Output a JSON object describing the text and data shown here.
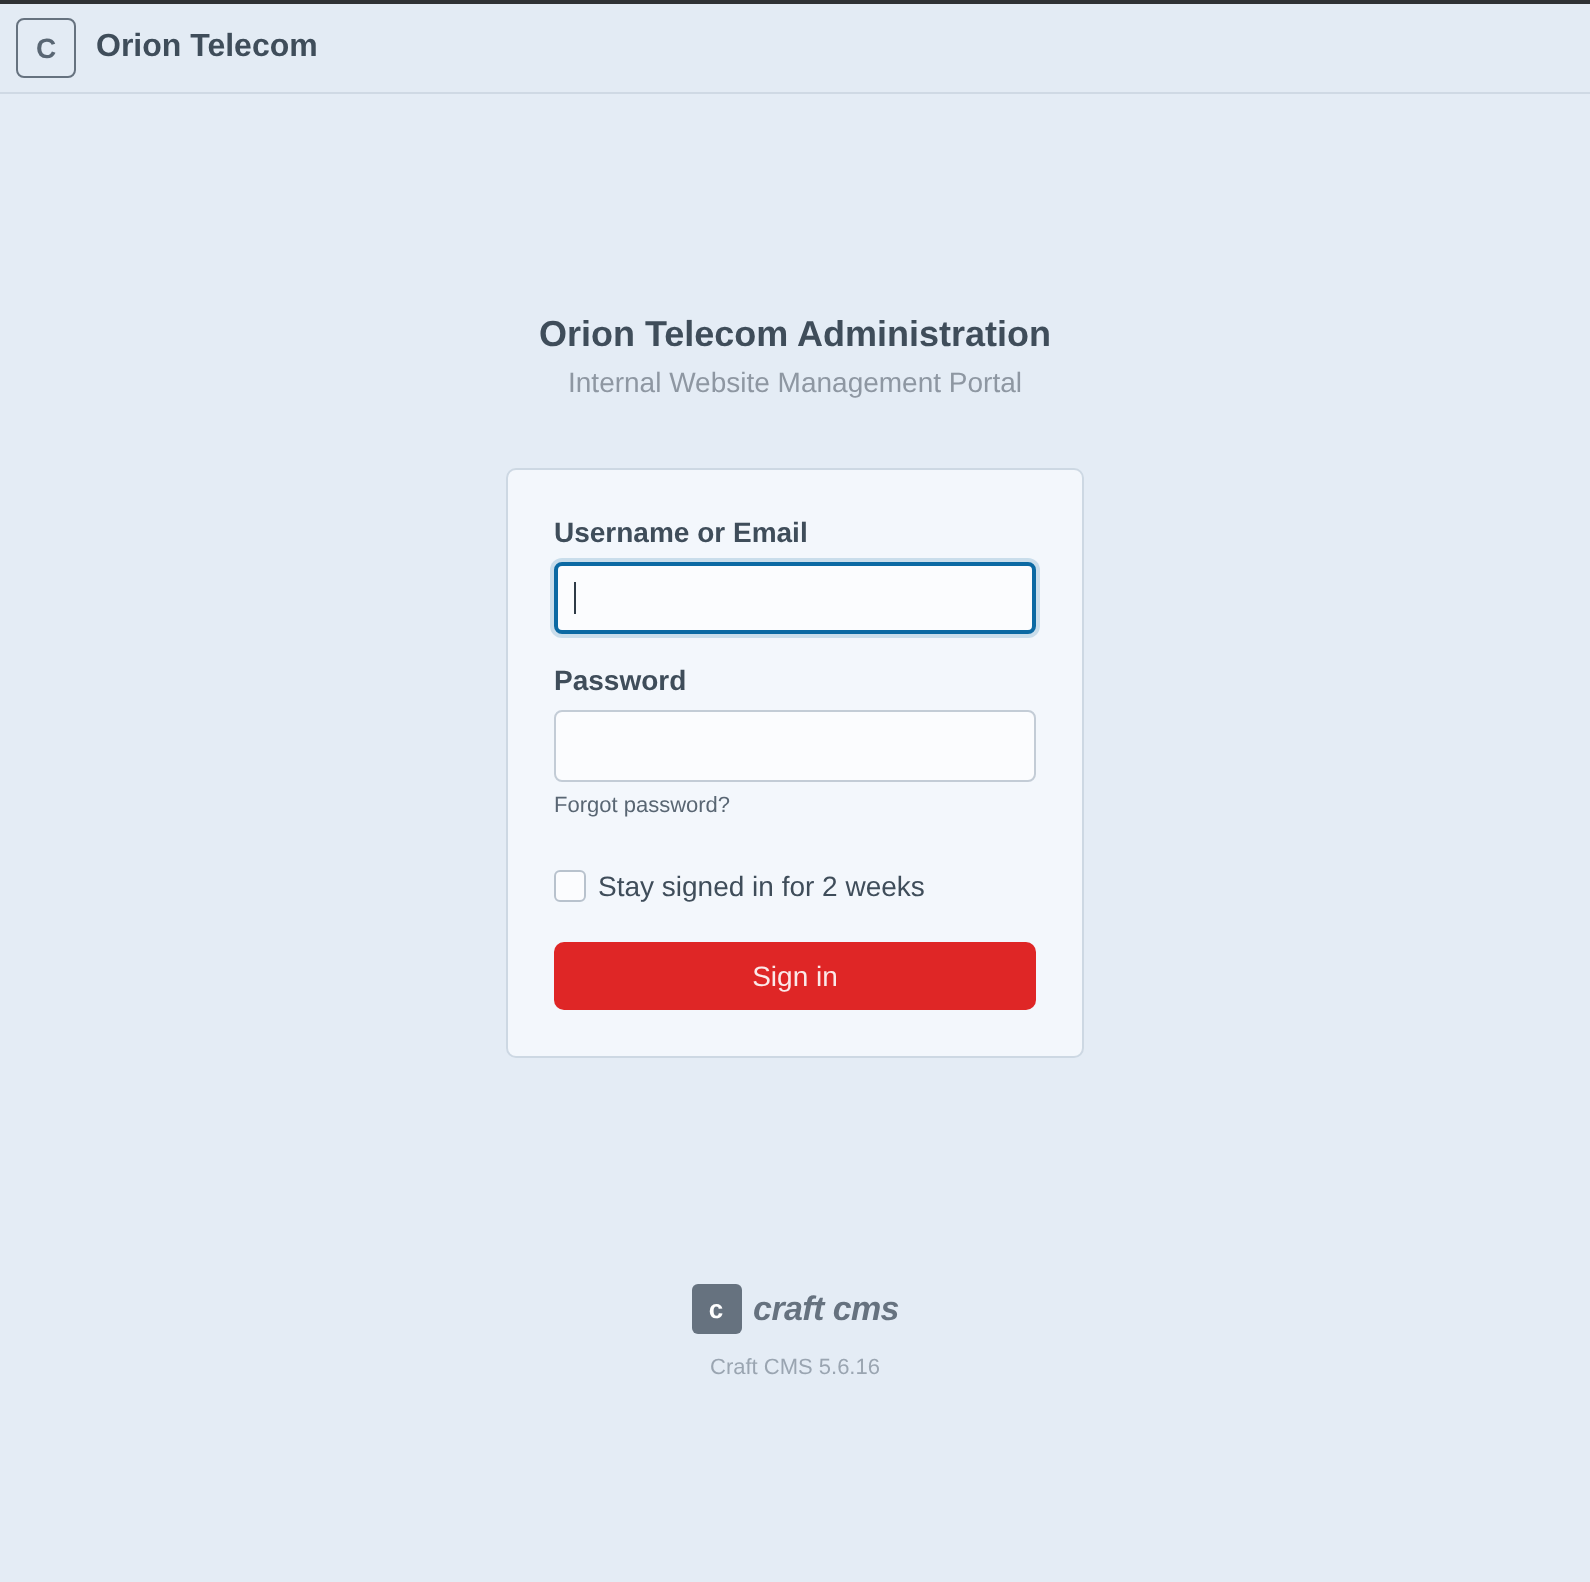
{
  "header": {
    "logo_letter": "C",
    "title": "Orion Telecom"
  },
  "heading": {
    "title": "Orion Telecom Administration",
    "subtitle": "Internal Website Management Portal"
  },
  "form": {
    "fields": [
      {
        "label": "Username or Email",
        "focused": true
      },
      {
        "label": "Password",
        "focused": false
      }
    ],
    "forgot_link": "Forgot password?",
    "remember": {
      "label": "Stay signed in for 2 weeks",
      "checked": false
    },
    "submit": "Sign in"
  },
  "footer": {
    "logo_letter": "c",
    "wordmark": "craft cms",
    "version": "Craft CMS 5.6.16"
  }
}
